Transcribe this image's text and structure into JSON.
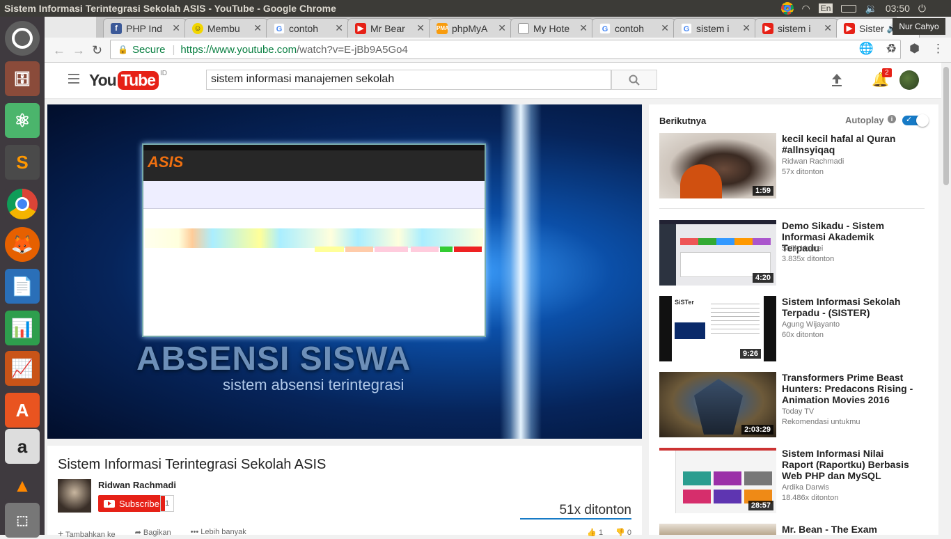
{
  "window": {
    "title": "Sistem Informasi Terintegrasi Sekolah ASIS - YouTube - Google Chrome"
  },
  "system_tray": {
    "keyboard": "En",
    "time": "03:50",
    "user": "Nur Cahyo"
  },
  "tabs": [
    {
      "label": "PHP Ind",
      "favicon": "facebook-icon",
      "color": "#3b5998"
    },
    {
      "label": "Membu",
      "favicon": "smiley-icon",
      "color": "#f2d600"
    },
    {
      "label": "contoh",
      "favicon": "google-icon",
      "color": "#4285f4"
    },
    {
      "label": "Mr Bear",
      "favicon": "youtube-icon",
      "color": "#e62117"
    },
    {
      "label": "phpMyA",
      "favicon": "phpmyadmin-icon",
      "color": "#f89c0e"
    },
    {
      "label": "My Hote",
      "favicon": "document-icon",
      "color": "#888888"
    },
    {
      "label": "contoh",
      "favicon": "google-icon",
      "color": "#4285f4"
    },
    {
      "label": "sistem i",
      "favicon": "google-icon",
      "color": "#4285f4"
    },
    {
      "label": "sistem i",
      "favicon": "youtube-icon",
      "color": "#e62117"
    },
    {
      "label": "Sister",
      "favicon": "youtube-icon",
      "color": "#e62117"
    }
  ],
  "address_bar": {
    "secure_label": "Secure",
    "url_host": "https://www.youtube.com",
    "url_path": "/watch?v=E-jBb9A5Go4"
  },
  "youtube": {
    "logo_you": "You",
    "logo_tube": "Tube",
    "logo_country": "ID",
    "search_value": "sistem informasi manajemen sekolah",
    "notification_count": "2"
  },
  "video": {
    "frame_title": "ABSENSI SISWA",
    "frame_subtitle": "sistem absensi terintegrasi",
    "app_logo": "ASIS",
    "title": "Sistem Informasi Terintegrasi Sekolah ASIS",
    "channel": "Ridwan Rachmadi",
    "subscribe_label": "Subscribe",
    "subscriber_count": "1",
    "views": "51x ditonton",
    "actions": [
      "Tambahkan ke",
      "Bagikan",
      "Lebih banyak"
    ],
    "likes": "1",
    "dislikes": "0"
  },
  "sidebar": {
    "next_label": "Berikutnya",
    "autoplay_label": "Autoplay",
    "autoplay_on": true,
    "videos": [
      {
        "title": "kecil kecil hafal al Quran #allnsyiqaq",
        "channel": "Ridwan Rachmadi",
        "views": "57x ditonton",
        "duration": "1:59"
      },
      {
        "title": "Demo Sikadu - Sistem Informasi Akademik Terpadu",
        "channel": "Sidik Hanrei",
        "views": "3.835x ditonton",
        "duration": "4:20"
      },
      {
        "title": "Sistem Informasi Sekolah Terpadu - (SISTER)",
        "channel": "Agung Wijayanto",
        "views": "60x ditonton",
        "duration": "9:26"
      },
      {
        "title": "Transformers Prime Beast Hunters: Predacons Rising - Animation Movies 2016",
        "channel": "Today TV",
        "views": "Rekomendasi untukmu",
        "duration": "2:03:29"
      },
      {
        "title": "Sistem Informasi Nilai Raport (Raportku) Berbasis Web PHP dan MySQL",
        "channel": "Ardika Darwis",
        "views": "18.486x ditonton",
        "duration": "28:57"
      },
      {
        "title": "Mr. Bean - The Exam",
        "channel": "",
        "views": "",
        "duration": ""
      }
    ]
  }
}
